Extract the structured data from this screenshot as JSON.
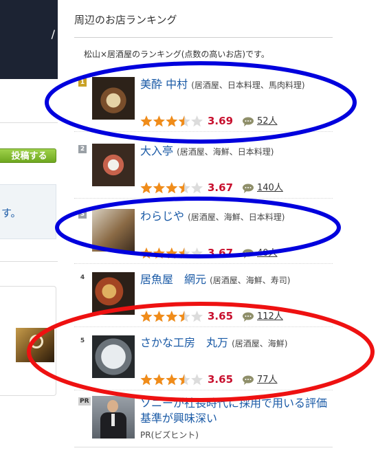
{
  "sidebar": {
    "post_button_label": "投稿する",
    "message_text": "す。"
  },
  "ranking": {
    "heading": "周辺のお店ランキング",
    "description": "松山×居酒屋のランキング(点数の高いお店)です。",
    "items": [
      {
        "rank": "1",
        "name": "美酔 中村",
        "categories": "(居酒屋、日本料理、馬肉料理)",
        "score": "3.69",
        "stars": 3.5,
        "reviews": "52人",
        "photo": "plate-of-sashimi"
      },
      {
        "rank": "2",
        "name": "大入亭",
        "categories": "(居酒屋、海鮮、日本料理)",
        "score": "3.67",
        "stars": 3.5,
        "reviews": "140人",
        "photo": "sashimi-platter"
      },
      {
        "rank": "3",
        "name": "わらじや",
        "categories": "(居酒屋、海鮮、日本料理)",
        "score": "3.67",
        "stars": 3.5,
        "reviews": "40人",
        "photo": "seafood-boat"
      },
      {
        "rank": "4",
        "name": "居魚屋　網元",
        "categories": "(居酒屋、海鮮、寿司)",
        "score": "3.65",
        "stars": 3.5,
        "reviews": "112人",
        "photo": "grilled-fish"
      },
      {
        "rank": "5",
        "name": "さかな工房　丸万",
        "categories": "(居酒屋、海鮮)",
        "score": "3.65",
        "stars": 3.5,
        "reviews": "77人",
        "photo": "fish-carpaccio"
      }
    ],
    "pr": {
      "badge": "PR",
      "title": "ソニーが社長時代に採用で用いる評価基準が興味深い",
      "source": "PR(ビズヒント)",
      "photo": "man-in-suit"
    }
  },
  "colors": {
    "link": "#1a5aa6",
    "score": "#c8102e",
    "star": "#f08c1a",
    "annotation_blue": "#0000dd",
    "annotation_red": "#ee1111"
  }
}
